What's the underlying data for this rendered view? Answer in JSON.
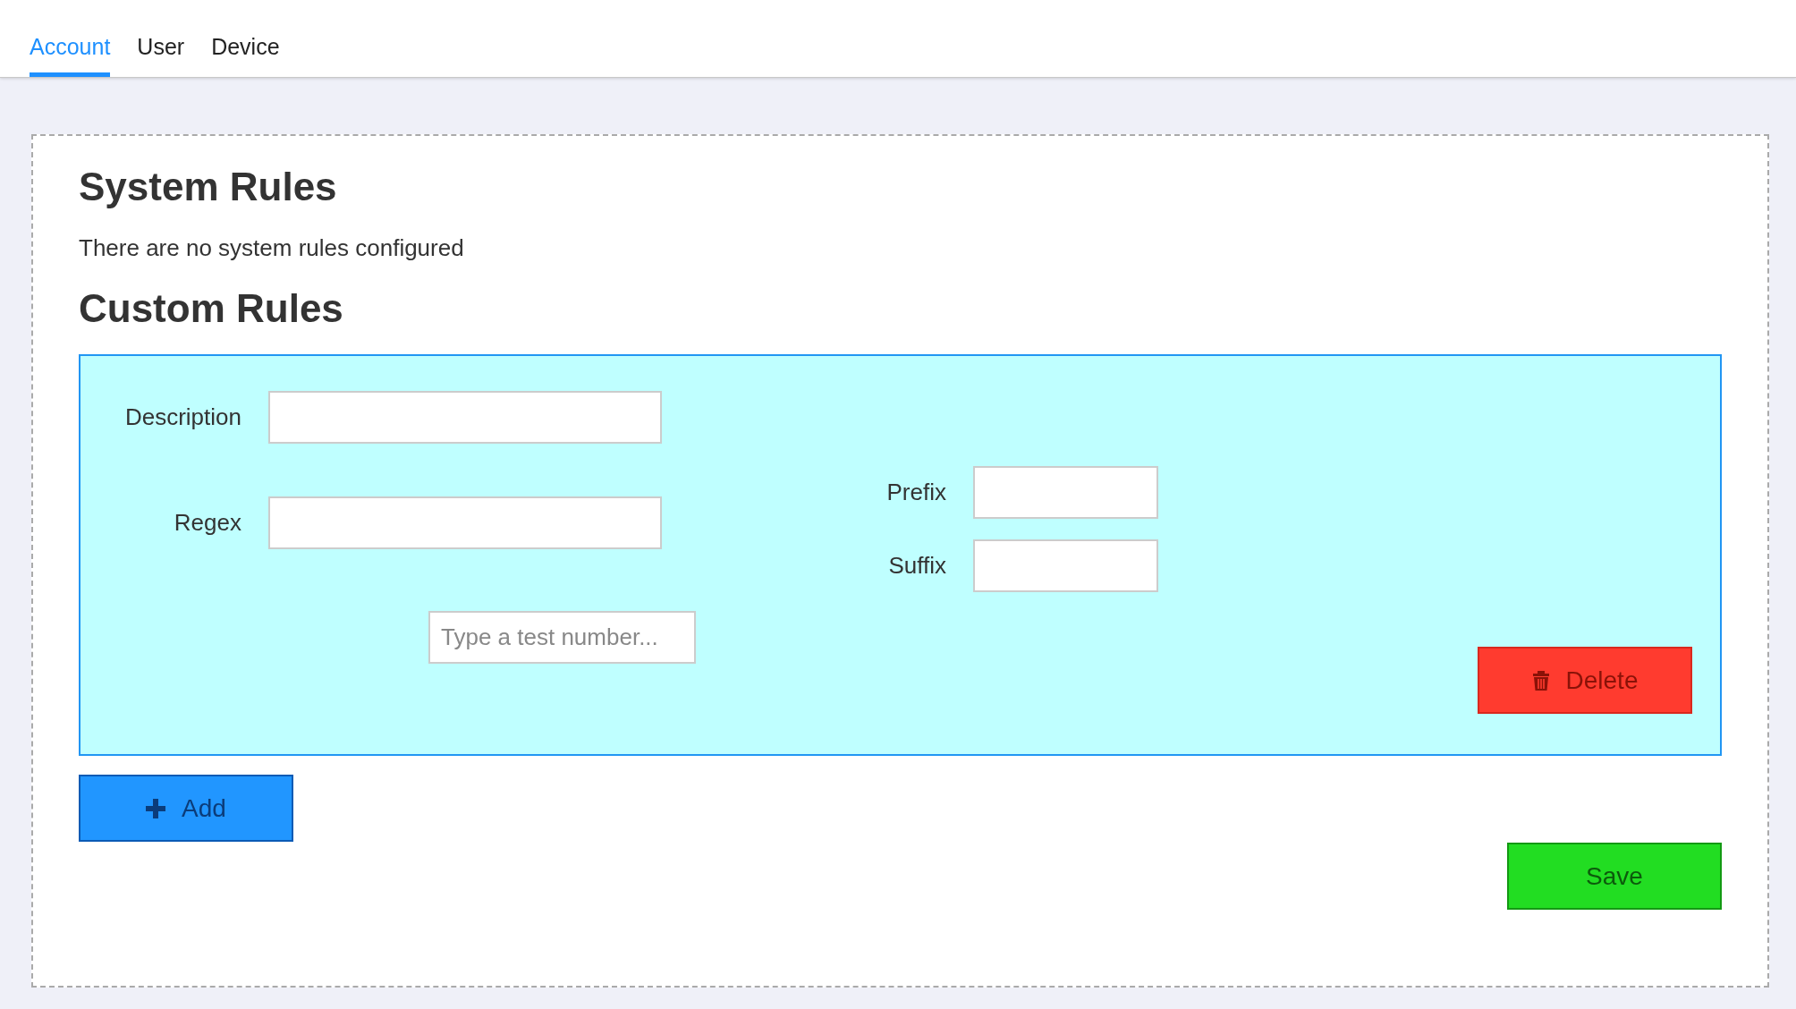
{
  "tabs": [
    {
      "label": "Account",
      "selected": true
    },
    {
      "label": "User",
      "selected": false
    },
    {
      "label": "Device",
      "selected": false
    }
  ],
  "system_rules": {
    "title": "System Rules",
    "message": "There are no system rules configured"
  },
  "custom_rules": {
    "title": "Custom Rules",
    "rules": [
      {
        "description_label": "Description",
        "regex_label": "Regex",
        "test_placeholder": "Type a test number...",
        "prefix_label": "Prefix",
        "suffix_label": "Suffix",
        "delete_button": "Delete"
      }
    ],
    "add_button": "Add"
  },
  "save_button": "Save"
}
